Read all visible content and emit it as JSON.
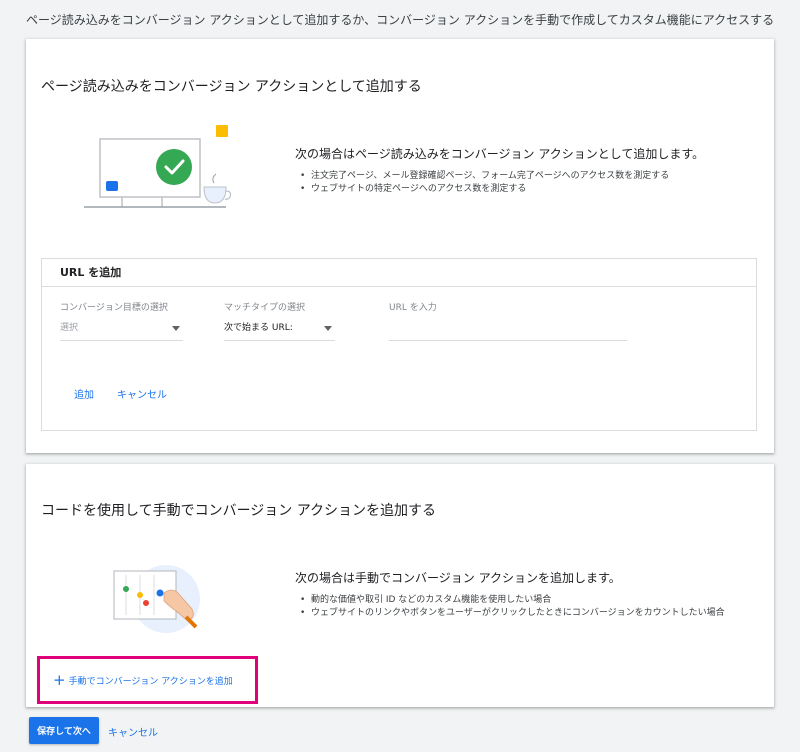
{
  "page": {
    "heading": "ページ読み込みをコンバージョン アクションとして追加するか、コンバージョン アクションを手動で作成してカスタム機能にアクセスする"
  },
  "page_load_section": {
    "title": "ページ読み込みをコンバージョン アクションとして追加する",
    "desc_title": "次の場合はページ読み込みをコンバージョン アクションとして追加します。",
    "bullets": [
      "注文完了ページ、メール登録確認ページ、フォーム完了ページへのアクセス数を測定する",
      "ウェブサイトの特定ページへのアクセス数を測定する"
    ],
    "url_panel": {
      "title": "URL を追加",
      "goal_label": "コンバージョン目標の選択",
      "goal_value": "選択",
      "match_label": "マッチタイプの選択",
      "match_value": "次で始まる URL:",
      "url_label": "URL を入力",
      "url_value": "",
      "add_label": "追加",
      "cancel_label": "キャンセル"
    }
  },
  "manual_section": {
    "title": "コードを使用して手動でコンバージョン アクションを追加する",
    "desc_title": "次の場合は手動でコンバージョン アクションを追加します。",
    "bullets": [
      "動的な価値や取引 ID などのカスタム機能を使用したい場合",
      "ウェブサイトのリンクやボタンをユーザーがクリックしたときにコンバージョンをカウントしたい場合"
    ],
    "add_manual_label": "手動でコンバージョン アクションを追加"
  },
  "footer": {
    "save_label": "保存して次へ",
    "cancel_label": "キャンセル"
  },
  "colors": {
    "accent": "#1a73e8",
    "highlight_border": "#e0007a",
    "check_green": "#34a853"
  },
  "icons": [
    "monitor-check-icon",
    "coffee-cup-icon",
    "chat-bubble-icon",
    "sticky-note-icon",
    "hand-touch-icon",
    "plus-icon",
    "dropdown-arrow-icon"
  ]
}
